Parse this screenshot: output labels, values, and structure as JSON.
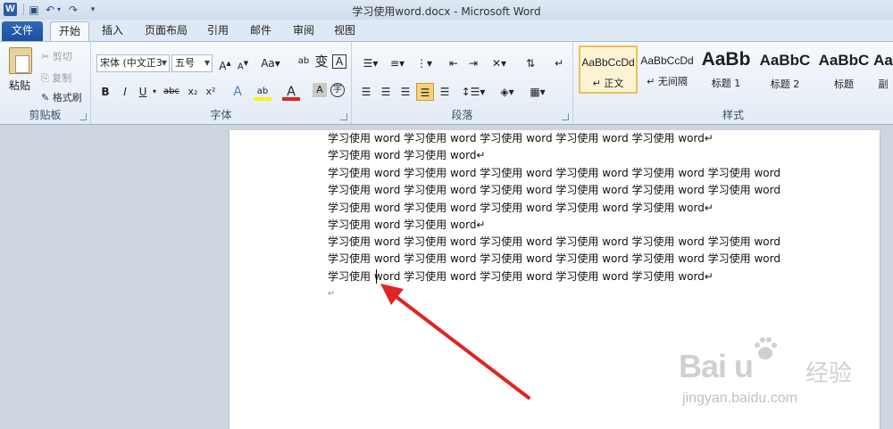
{
  "window": {
    "title": "学习使用word.docx - Microsoft Word",
    "logo_letter": "W"
  },
  "tabs": [
    {
      "label": "文件"
    },
    {
      "label": "开始"
    },
    {
      "label": "插入"
    },
    {
      "label": "页面布局"
    },
    {
      "label": "引用"
    },
    {
      "label": "邮件"
    },
    {
      "label": "审阅"
    },
    {
      "label": "视图"
    }
  ],
  "clipboard": {
    "paste": "粘贴",
    "cut": "剪切",
    "copy": "复制",
    "format_painter": "格式刷",
    "group_label": "剪贴板"
  },
  "font": {
    "font_name": "宋体 (中文正3",
    "font_size": "五号",
    "group_label": "字体"
  },
  "paragraph": {
    "group_label": "段落"
  },
  "styles": {
    "group_label": "样式",
    "items": [
      {
        "sample": "AaBbCcDd",
        "name": "↵ 正文"
      },
      {
        "sample": "AaBbCcDd",
        "name": "↵ 无间隔"
      },
      {
        "sample": "AaBb",
        "name": "标题 1"
      },
      {
        "sample": "AaBbC",
        "name": "标题 2"
      },
      {
        "sample": "AaBbC",
        "name": "标题"
      },
      {
        "sample": "Aa",
        "name": "副"
      }
    ]
  },
  "document": {
    "lines": [
      "学习使用 word 学习使用 word 学习使用 word 学习使用 word 学习使用 word↵",
      "学习使用 word 学习使用 word↵",
      "学习使用 word 学习使用 word 学习使用 word 学习使用 word 学习使用 word 学习使用 word",
      "学习使用 word 学习使用 word 学习使用 word 学习使用 word 学习使用 word 学习使用 word",
      "学习使用 word 学习使用 word 学习使用 word 学习使用 word 学习使用 word↵",
      "学习使用 word 学习使用 word↵",
      "学习使用 word 学习使用 word 学习使用 word 学习使用 word 学习使用 word 学习使用 word",
      "学习使用 word 学习使用 word 学习使用 word 学习使用 word 学习使用 word 学习使用 word",
      "学习使用 word 学习使用 word 学习使用 word 学习使用 word 学习使用 word↵",
      "↵"
    ]
  },
  "watermark": {
    "logo": "Bai  u",
    "cn": "经验",
    "url": "jingyan.baidu.com"
  },
  "colors": {
    "annotation_arrow": "#e02424",
    "file_tab": "#2a5da8"
  }
}
